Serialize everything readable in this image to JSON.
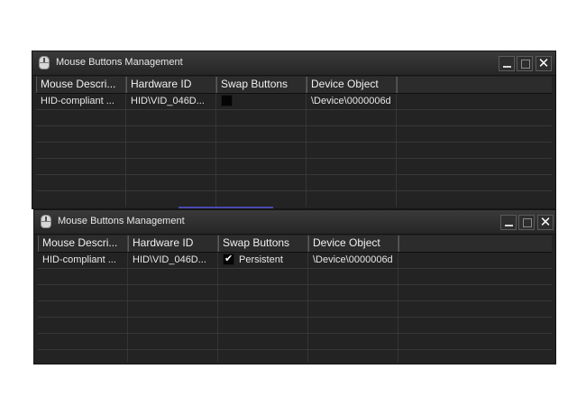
{
  "windows": [
    {
      "title": "Mouse Buttons Management",
      "columns": [
        "Mouse Descri...",
        "Hardware ID",
        "Swap Buttons",
        "Device Object",
        ""
      ],
      "rows": [
        {
          "description": "HID-compliant ...",
          "hardware_id": "HID\\VID_046D...",
          "swap_checked": false,
          "swap_label": "",
          "device_object": "\\Device\\0000006d"
        }
      ]
    },
    {
      "title": "Mouse Buttons Management",
      "columns": [
        "Mouse Descri...",
        "Hardware ID",
        "Swap Buttons",
        "Device Object",
        ""
      ],
      "rows": [
        {
          "description": "HID-compliant ...",
          "hardware_id": "HID\\VID_046D...",
          "swap_checked": true,
          "swap_label": "Persistent",
          "device_object": "\\Device\\0000006d"
        }
      ]
    }
  ],
  "icons": {
    "app": "mouse-icon",
    "minimize": "minimize-icon",
    "maximize": "maximize-icon",
    "close": "close-icon"
  },
  "colors": {
    "window_bg": "#232323",
    "header_bg": "#2c2c2c",
    "text": "#e6e6e6"
  }
}
